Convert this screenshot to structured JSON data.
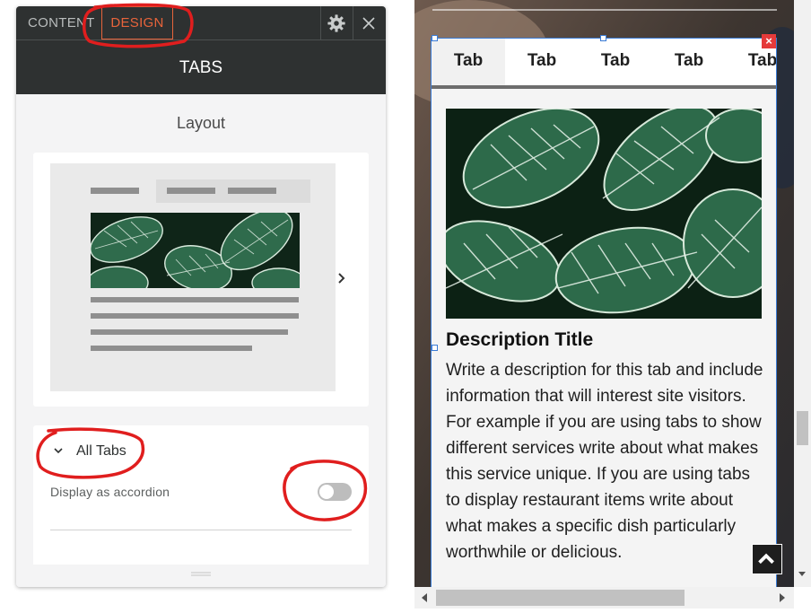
{
  "panel": {
    "tabs": {
      "content": "CONTENT",
      "design": "DESIGN"
    },
    "title": "TABS",
    "layout_section": {
      "label": "Layout"
    },
    "all_tabs": {
      "label": "All Tabs",
      "accordion_label": "Display as accordion",
      "accordion_enabled": false
    }
  },
  "widget": {
    "tabs": [
      "Tab",
      "Tab",
      "Tab",
      "Tab",
      "Tab"
    ],
    "active_tab_index": 0,
    "description_title": "Description Title",
    "description_text": "Write a description for this tab and include information that will interest site visitors. For example if you are using tabs to show different services write about what makes this service unique. If you are using tabs to display restaurant items write about what makes a specific dish particularly worthwhile or delicious.",
    "delete_label": "×"
  },
  "colors": {
    "accent": "#e8643b",
    "selection": "#3a7bd5",
    "topbar": "#2e3131",
    "annotation": "#e01e1e"
  },
  "icons": [
    "gear-icon",
    "close-icon",
    "chevron-right-icon",
    "chevron-down-icon",
    "grip-icon",
    "arrow-up-icon"
  ]
}
